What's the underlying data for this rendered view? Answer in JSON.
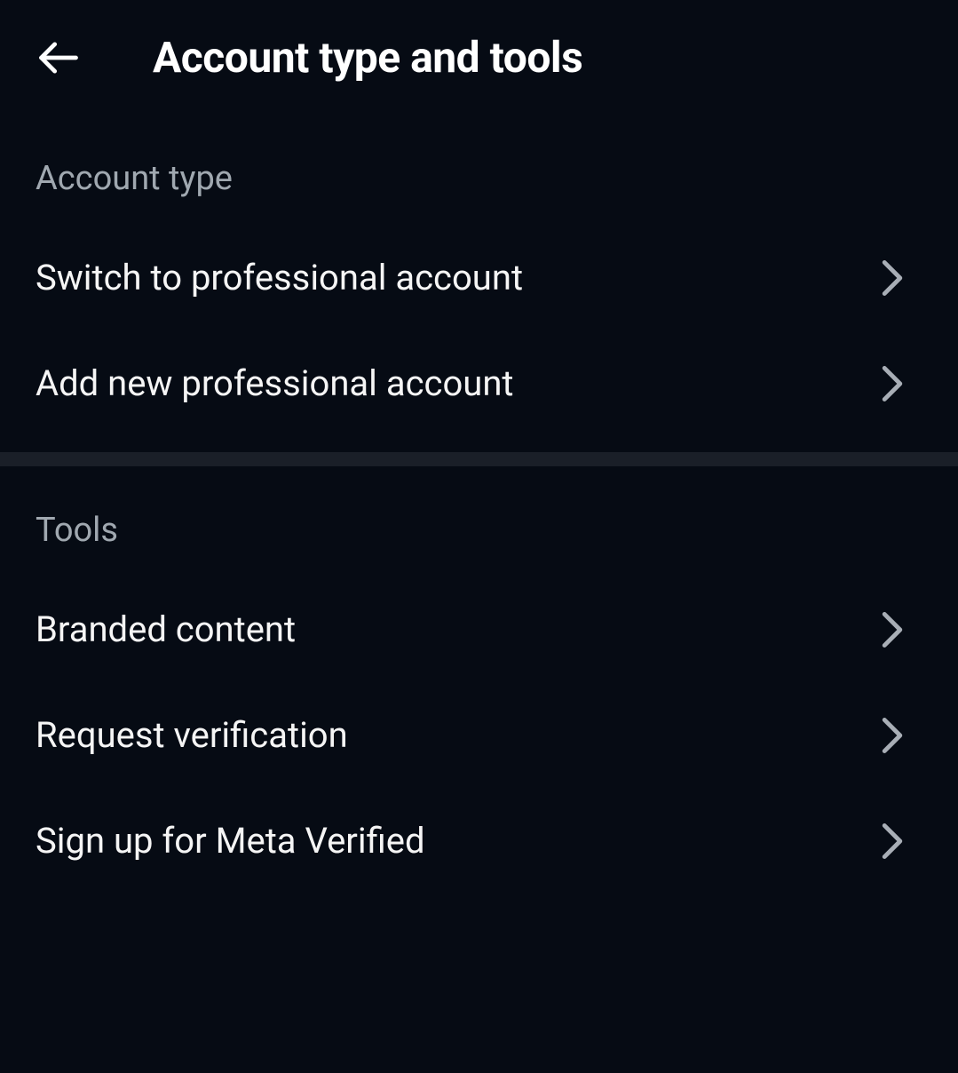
{
  "header": {
    "title": "Account type and tools"
  },
  "sections": {
    "account_type": {
      "header": "Account type",
      "items": {
        "switch_professional": "Switch to professional account",
        "add_professional": "Add new professional account"
      }
    },
    "tools": {
      "header": "Tools",
      "items": {
        "branded_content": "Branded content",
        "request_verification": "Request verification",
        "meta_verified": "Sign up for Meta Verified"
      }
    }
  }
}
